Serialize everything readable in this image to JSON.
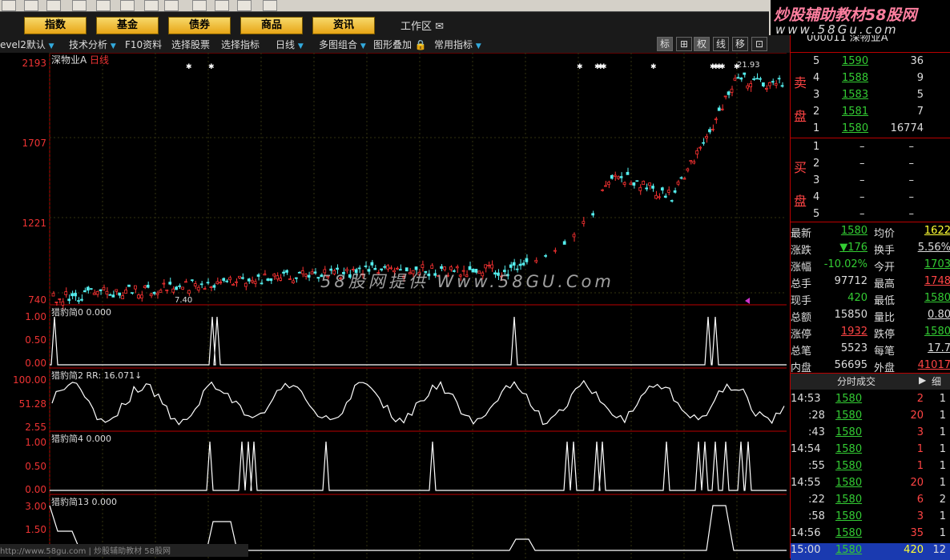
{
  "menu": [
    "指数",
    "基金",
    "债券",
    "商品",
    "资讯"
  ],
  "workzone": "工作区",
  "brand": {
    "line1": "炒股辅助教材58股网",
    "line2": "www.58Gu.com"
  },
  "toolbar2": [
    "evel2默认",
    "技术分析",
    "F10资料",
    "选择股票",
    "选择指标",
    "日线",
    "多图组合",
    "图形叠加",
    "常用指标"
  ],
  "toolbar2_btns": [
    "标",
    "⊞",
    "权",
    "线",
    "移",
    "⊡"
  ],
  "chart": {
    "stock_name": "深物业A",
    "period": "日线",
    "price_labels": [
      "2193",
      "1707",
      "1221",
      "740"
    ],
    "peak_label": "21.93",
    "low_label": "7.40",
    "watermark": "58股网提供 Www.58GU.Com",
    "pane1": {
      "title": "猎豹简0 0.000",
      "labels": [
        "1.00",
        "0.50",
        "0.00"
      ]
    },
    "pane2": {
      "title": "猎豹简2 RR: 16.071↓",
      "labels": [
        "100.00",
        "51.28",
        "2.55"
      ]
    },
    "pane3": {
      "title": "猎豹简4 0.000",
      "labels": [
        "1.00",
        "0.50",
        "0.00"
      ]
    },
    "pane4": {
      "title": "猎豹简13 0.000",
      "labels": [
        "3.00",
        "1.50"
      ]
    },
    "statusbar": "http://www.58gu.com  | 炒股辅助教材 58股网"
  },
  "quote": {
    "code": "000011 深物业A",
    "sell_label": [
      "卖",
      "盘"
    ],
    "buy_label": [
      "买",
      "盘"
    ],
    "sell": [
      [
        "5",
        "1590",
        "36"
      ],
      [
        "4",
        "1588",
        "9"
      ],
      [
        "3",
        "1583",
        "5"
      ],
      [
        "2",
        "1581",
        "7"
      ],
      [
        "1",
        "1580",
        "16774"
      ]
    ],
    "buy": [
      [
        "1",
        "–",
        "–"
      ],
      [
        "2",
        "–",
        "–"
      ],
      [
        "3",
        "–",
        "–"
      ],
      [
        "4",
        "–",
        "–"
      ],
      [
        "5",
        "–",
        "–"
      ]
    ],
    "stats": [
      [
        "最新",
        "1580",
        "均价",
        "1622"
      ],
      [
        "涨跌",
        "▼176",
        "换手",
        "5.56%"
      ],
      [
        "涨幅",
        "-10.02%",
        "今开",
        "1703"
      ],
      [
        "总手",
        "97712",
        "最高",
        "1748"
      ],
      [
        "现手",
        "420",
        "最低",
        "1580"
      ],
      [
        "总额",
        "15850",
        "量比",
        "0.80"
      ],
      [
        "涨停",
        "1932",
        "跌停",
        "1580"
      ],
      [
        "总笔",
        "5523",
        "每笔",
        "17.7"
      ],
      [
        "内盘",
        "56695",
        "外盘",
        "41017"
      ]
    ],
    "ticks_title": "分时成交",
    "ticks_detail": "细",
    "ticks": [
      [
        "14:53",
        "1580",
        "2",
        "1"
      ],
      [
        ":28",
        "1580",
        "20",
        "1"
      ],
      [
        ":43",
        "1580",
        "3",
        "1"
      ],
      [
        "14:54",
        "1580",
        "1",
        "1"
      ],
      [
        ":55",
        "1580",
        "1",
        "1"
      ],
      [
        "14:55",
        "1580",
        "20",
        "1"
      ],
      [
        ":22",
        "1580",
        "6",
        "2"
      ],
      [
        ":58",
        "1580",
        "3",
        "1"
      ],
      [
        "14:56",
        "1580",
        "35",
        "1"
      ],
      [
        "15:00",
        "1580",
        "420",
        "12"
      ]
    ]
  }
}
